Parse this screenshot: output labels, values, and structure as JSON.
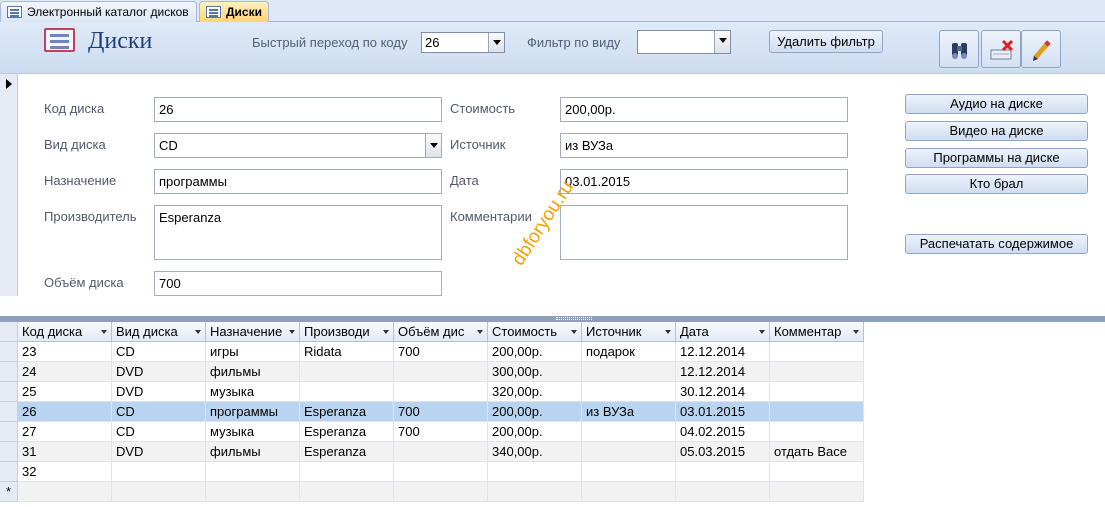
{
  "tabs": [
    {
      "label": "Электронный каталог дисков",
      "active": false
    },
    {
      "label": "Диски",
      "active": true
    }
  ],
  "header": {
    "title": "Диски",
    "quick_jump_label": "Быстрый переход по коду",
    "quick_jump_value": "26",
    "filter_label": "Фильтр  по виду",
    "filter_value": "",
    "remove_filter_label": "Удалить фильтр",
    "tools": [
      "binoculars-icon",
      "delete-record-icon",
      "edit-pencil-icon"
    ]
  },
  "form": {
    "code_label": "Код диска",
    "code_value": "26",
    "type_label": "Вид диска",
    "type_value": "CD",
    "purpose_label": "Назначение",
    "purpose_value": "программы",
    "maker_label": "Производитель",
    "maker_value": "Esperanza",
    "volume_label": "Объём диска",
    "volume_value": "700",
    "price_label": "Стоимость",
    "price_value": "200,00р.",
    "source_label": "Источник",
    "source_value": "из ВУЗа",
    "date_label": "Дата",
    "date_value": "03.01.2015",
    "comment_label": "Комментарии",
    "comment_value": ""
  },
  "side_buttons": {
    "audio": "Аудио на диске",
    "video": "Видео на диске",
    "programs": "Программы на диске",
    "who_took": "Кто брал",
    "print": "Распечатать содержимое"
  },
  "watermark": "dbforyou.ru",
  "datasheet": {
    "columns": [
      "Код диска",
      "Вид диска",
      "Назначение",
      "Производи",
      "Объём дис",
      "Стоимость",
      "Источник",
      "Дата",
      "Комментар"
    ],
    "rows": [
      [
        "23",
        "CD",
        "игры",
        "Ridata",
        "700",
        "200,00р.",
        "подарок",
        "12.12.2014",
        ""
      ],
      [
        "24",
        "DVD",
        "фильмы",
        "",
        "",
        "300,00р.",
        "",
        "12.12.2014",
        ""
      ],
      [
        "25",
        "DVD",
        "музыка",
        "",
        "",
        "320,00р.",
        "",
        "30.12.2014",
        ""
      ],
      [
        "26",
        "CD",
        "программы",
        "Esperanza",
        "700",
        "200,00р.",
        "из ВУЗа",
        "03.01.2015",
        ""
      ],
      [
        "27",
        "CD",
        "музыка",
        "Esperanza",
        "700",
        "200,00р.",
        "",
        "04.02.2015",
        ""
      ],
      [
        "31",
        "DVD",
        "фильмы",
        "Esperanza",
        "",
        "340,00р.",
        "",
        "05.03.2015",
        "отдать Васе"
      ],
      [
        "32",
        "",
        "",
        "",
        "",
        "",
        "",
        "",
        ""
      ]
    ],
    "selected_row": 3,
    "new_row_marker": "*"
  }
}
